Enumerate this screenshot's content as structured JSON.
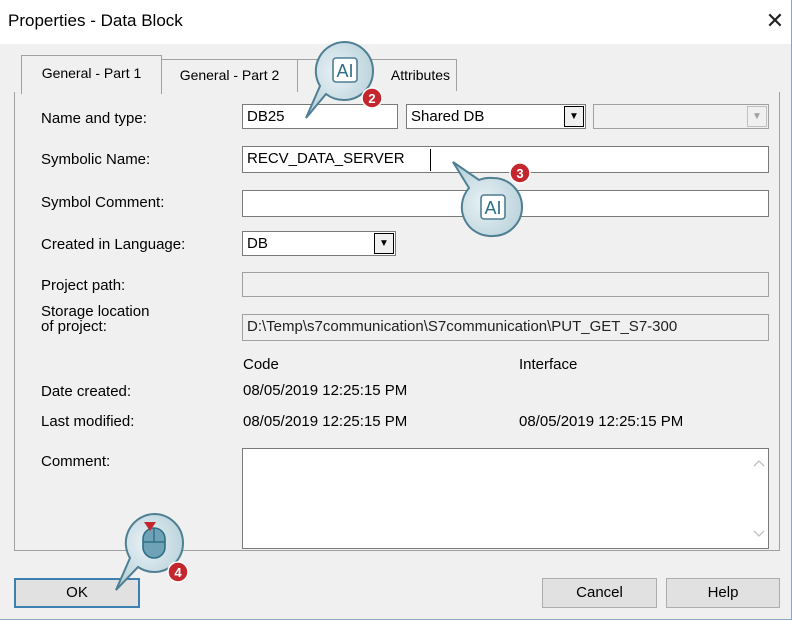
{
  "window": {
    "title": "Properties - Data Block",
    "close_glyph": "✕"
  },
  "tabs": [
    {
      "label": "General - Part 1",
      "active": true
    },
    {
      "label": "General - Part 2",
      "active": false
    },
    {
      "label": "Attributes",
      "active": false
    }
  ],
  "form": {
    "name_type_label": "Name and type:",
    "name_value": "DB25",
    "type_value": "Shared DB",
    "type_extra_value": "",
    "symbolic_name_label": "Symbolic Name:",
    "symbolic_name_value": "RECV_DATA_SERVER",
    "symbol_comment_label": "Symbol Comment:",
    "symbol_comment_value": "",
    "created_language_label": "Created in Language:",
    "created_language_value": "DB",
    "project_path_label": "Project path:",
    "project_path_value": "",
    "storage_location_label_1": "Storage location",
    "storage_location_label_2": "of project:",
    "storage_location_value": "D:\\Temp\\s7communication\\S7communication\\PUT_GET_S7-300",
    "code_header": "Code",
    "interface_header": "Interface",
    "date_created_label": "Date created:",
    "date_created_code": "08/05/2019 12:25:15 PM",
    "last_modified_label": "Last modified:",
    "last_modified_code": "08/05/2019 12:25:15 PM",
    "last_modified_interface": "08/05/2019 12:25:15 PM",
    "comment_label": "Comment:",
    "comment_value": ""
  },
  "buttons": {
    "ok": "OK",
    "cancel": "Cancel",
    "help": "Help"
  },
  "callouts": [
    {
      "step": "2",
      "icon": "text-input-icon",
      "glyph": "AI"
    },
    {
      "step": "3",
      "icon": "text-input-icon",
      "glyph": "AI"
    },
    {
      "step": "4",
      "icon": "mouse-click-icon"
    }
  ],
  "colors": {
    "callout_fill": "#c9dce3",
    "callout_stroke": "#4f7f93",
    "badge": "#c4262e",
    "default_button_border": "#3c7fb1"
  }
}
